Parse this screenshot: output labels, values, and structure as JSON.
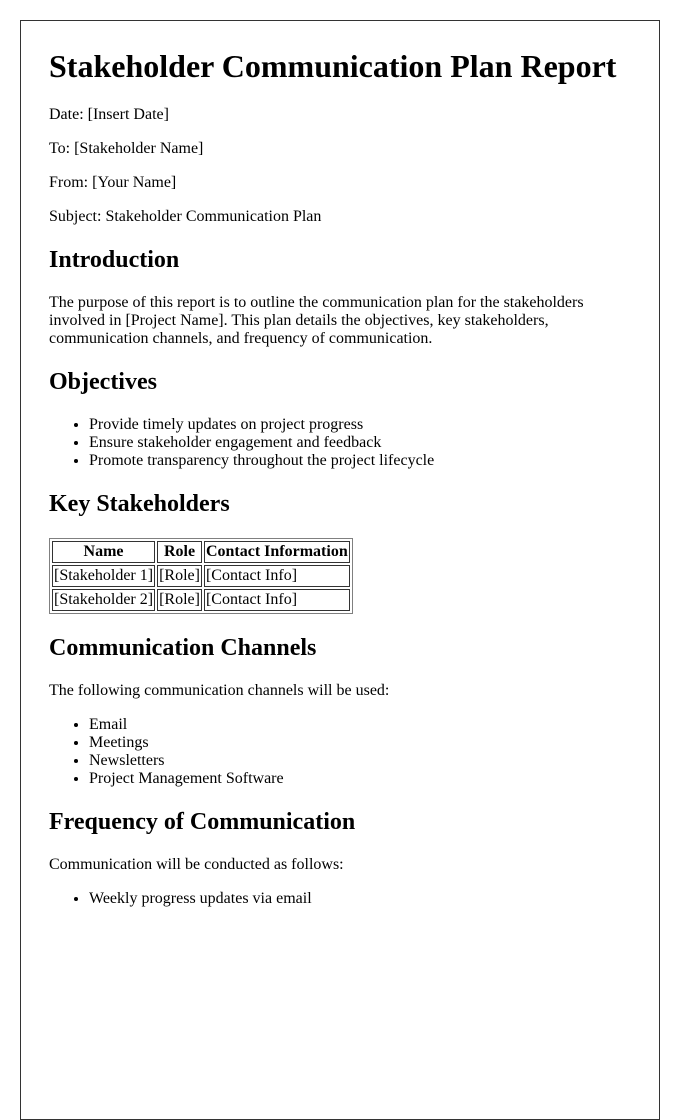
{
  "document": {
    "title": "Stakeholder Communication Plan Report",
    "header_fields": [
      {
        "label": "Date:",
        "value": "[Insert Date]"
      },
      {
        "label": "To:",
        "value": "[Stakeholder Name]"
      },
      {
        "label": "From:",
        "value": "[Your Name]"
      },
      {
        "label": "Subject:",
        "value": "Stakeholder Communication Plan"
      }
    ],
    "header_lines": [
      "Date: [Insert Date]",
      "To: [Stakeholder Name]",
      "From: [Your Name]",
      "Subject: Stakeholder Communication Plan"
    ]
  },
  "sections": {
    "introduction": {
      "heading": "Introduction",
      "body": "The purpose of this report is to outline the communication plan for the stakeholders involved in [Project Name]. This plan details the objectives, key stakeholders, communication channels, and frequency of communication."
    },
    "objectives": {
      "heading": "Objectives",
      "items": [
        "Provide timely updates on project progress",
        "Ensure stakeholder engagement and feedback",
        "Promote transparency throughout the project lifecycle"
      ]
    },
    "key_stakeholders": {
      "heading": "Key Stakeholders",
      "table": {
        "columns": [
          "Name",
          "Role",
          "Contact Information"
        ],
        "rows": [
          [
            "[Stakeholder 1]",
            "[Role]",
            "[Contact Info]"
          ],
          [
            "[Stakeholder 2]",
            "[Role]",
            "[Contact Info]"
          ]
        ]
      }
    },
    "communication_channels": {
      "heading": "Communication Channels",
      "intro": "The following communication channels will be used:",
      "items": [
        "Email",
        "Meetings",
        "Newsletters",
        "Project Management Software"
      ]
    },
    "frequency": {
      "heading": "Frequency of Communication",
      "intro": "Communication will be conducted as follows:",
      "items": [
        "Weekly progress updates via email"
      ]
    }
  },
  "colors": {
    "page_border": "#333333",
    "table_outer_border": "#808080",
    "text": "#000000",
    "background": "#ffffff"
  }
}
